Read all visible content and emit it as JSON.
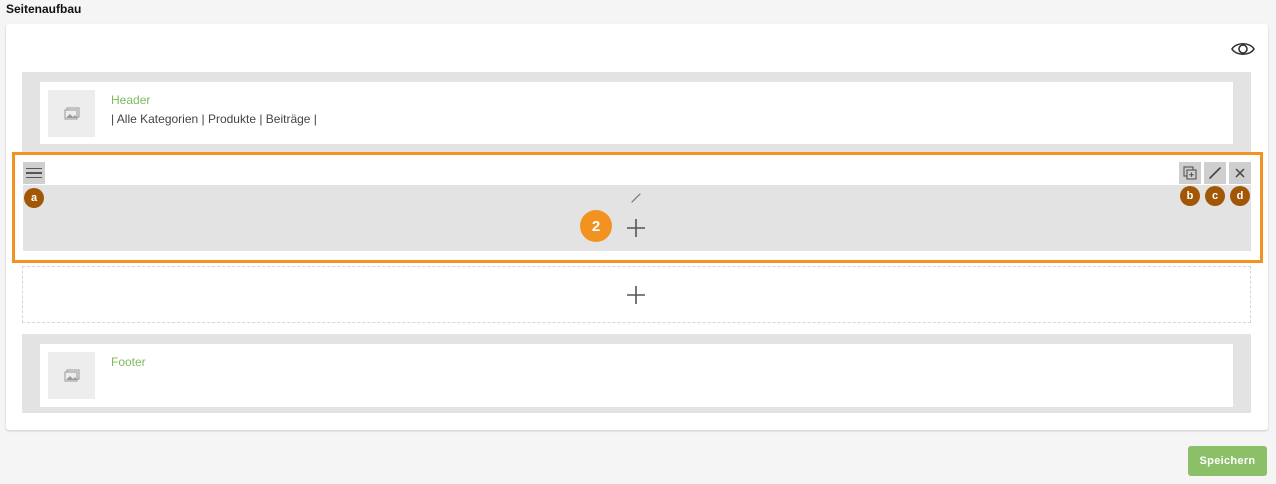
{
  "page": {
    "title": "Seitenaufbau"
  },
  "header_region": {
    "title": "Header",
    "subtitle": "| Alle Kategorien | Produkte | Beiträge |"
  },
  "section": {
    "marker_main": "2",
    "marker_handle": "a",
    "marker_duplicate": "b",
    "marker_edit": "c",
    "marker_delete": "d"
  },
  "footer_region": {
    "title": "Footer"
  },
  "actions": {
    "save_label": "Speichern"
  },
  "colors": {
    "highlight": "#f29321",
    "marker": "#a25707",
    "accent_green": "#7dbb5a",
    "save_button": "#8bc068"
  },
  "icons": [
    "eye-icon",
    "image-placeholder-icon",
    "menu-icon",
    "duplicate-icon",
    "pencil-icon",
    "close-icon",
    "plus-icon"
  ]
}
